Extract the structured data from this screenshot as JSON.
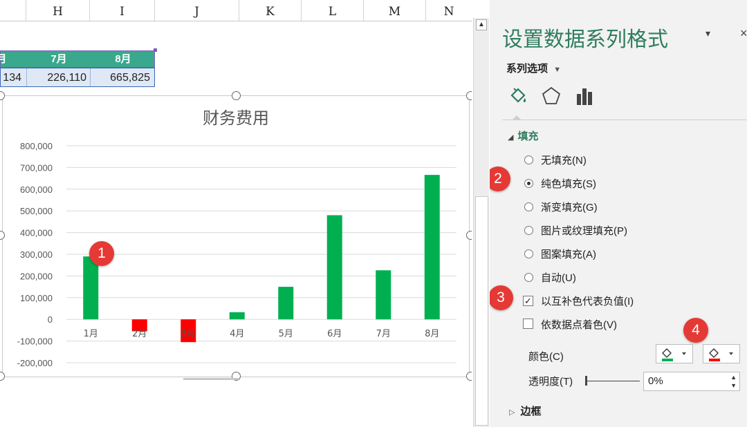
{
  "sheet": {
    "columns": [
      "H",
      "I",
      "J",
      "K",
      "L",
      "M",
      "N"
    ],
    "table": {
      "headers": [
        "月",
        "7月",
        "8月"
      ],
      "values": [
        "134",
        "226,110",
        "665,825"
      ]
    }
  },
  "chart_data": {
    "type": "bar",
    "title": "财务费用",
    "categories": [
      "1月",
      "2月",
      "3月",
      "4月",
      "5月",
      "6月",
      "7月",
      "8月"
    ],
    "values": [
      290000,
      -55000,
      -105000,
      33000,
      150000,
      480000,
      226110,
      665825
    ],
    "ylim": [
      -200000,
      800000
    ],
    "yticks": [
      "800,000",
      "700,000",
      "600,000",
      "500,000",
      "400,000",
      "300,000",
      "200,000",
      "100,000",
      "0",
      "-100,000",
      "-200,000"
    ],
    "grid": true,
    "colors": {
      "positive": "#00b050",
      "negative": "#ff0000"
    }
  },
  "pane": {
    "title": "设置数据系列格式",
    "section_dropdown": "系列选项",
    "tabs": [
      "fill-line-icon",
      "effects-pentagon-icon",
      "bar-chart-icon"
    ],
    "fill_heading": "填充",
    "fill_options": [
      "无填充(N)",
      "纯色填充(S)",
      "渐变填充(G)",
      "图片或纹理填充(P)",
      "图案填充(A)",
      "自动(U)"
    ],
    "invert_if_negative": "以互补色代表负值(I)",
    "vary_by_point": "依数据点着色(V)",
    "color_label": "颜色(C)",
    "transparency_label": "透明度(T)",
    "transparency_value": "0%",
    "border_heading": "边框",
    "color_swatches": {
      "primary": "#00b050",
      "invert": "#ff0000"
    }
  },
  "annotations": [
    "1",
    "2",
    "3",
    "4"
  ]
}
